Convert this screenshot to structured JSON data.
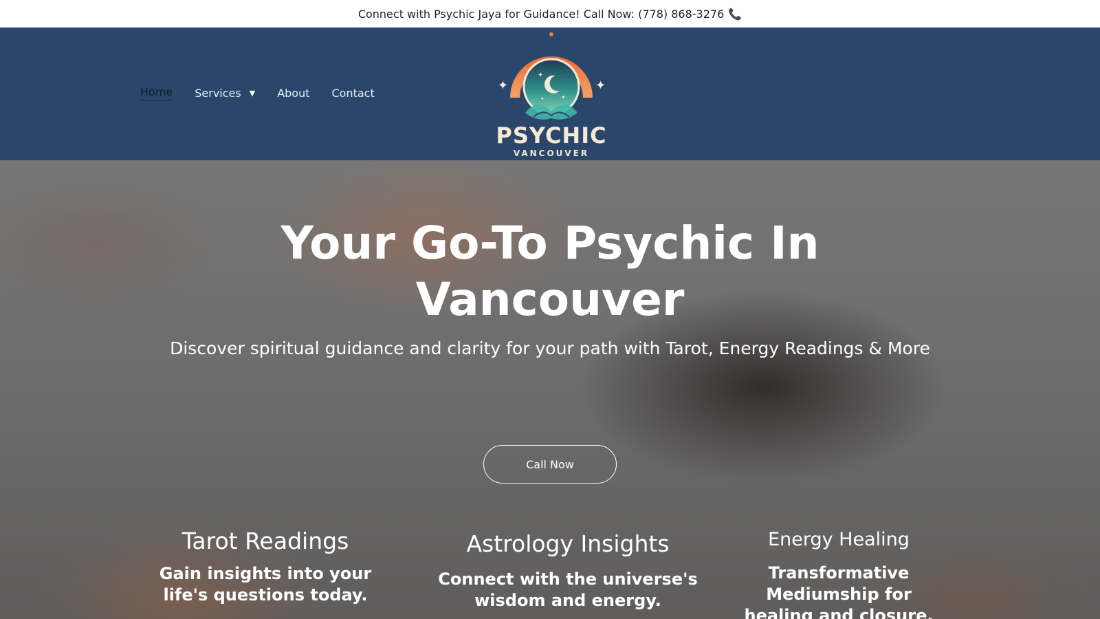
{
  "announcement": {
    "text": "Connect with Psychic Jaya for Guidance! Call Now: (778) 868-3276",
    "icon": "phone-icon"
  },
  "nav": {
    "items": [
      {
        "label": "Home"
      },
      {
        "label": "Services"
      },
      {
        "label": "About"
      },
      {
        "label": "Contact"
      }
    ]
  },
  "logo": {
    "word": "PSYCHIC",
    "sub": "VANCOUVER"
  },
  "hero": {
    "title": "Your Go-To Psychic In Vancouver",
    "subtitle": "Discover spiritual guidance and clarity for your path with Tarot, Energy Readings & More",
    "cta": "Call Now"
  },
  "cards": [
    {
      "title": "Tarot Readings",
      "desc": "Gain insights into your life's questions today."
    },
    {
      "title": "Astrology Insights",
      "desc": "Connect with the universe's wisdom and energy."
    },
    {
      "title": "Energy Healing",
      "desc": "Transformative Mediumship for healing and closure."
    }
  ],
  "colors": {
    "header_bg": "#2a476b",
    "logo_orange": "#e97a4a",
    "logo_teal": "#3fb6a8"
  }
}
